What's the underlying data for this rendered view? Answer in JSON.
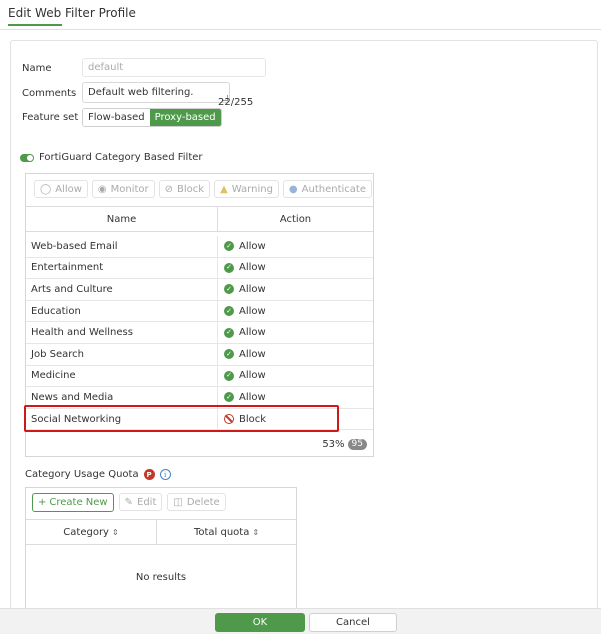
{
  "dialog": {
    "title": "Edit Web Filter Profile"
  },
  "form": {
    "name_label": "Name",
    "name_value": "default",
    "comments_label": "Comments",
    "comments_value": "Default web filtering.",
    "comments_counter": "22/255",
    "feature_set_label": "Feature set",
    "feature_set_options": [
      "Flow-based",
      "Proxy-based"
    ],
    "feature_set_selected": "Proxy-based"
  },
  "fortiguard": {
    "enabled": true,
    "title": "FortiGuard Category Based Filter",
    "toolbar": [
      {
        "label": "Allow",
        "icon": "check-circle-icon"
      },
      {
        "label": "Monitor",
        "icon": "eye-icon"
      },
      {
        "label": "Block",
        "icon": "block-icon"
      },
      {
        "label": "Warning",
        "icon": "warning-icon"
      },
      {
        "label": "Authenticate",
        "icon": "user-icon"
      }
    ],
    "columns": {
      "name": "Name",
      "action": "Action"
    },
    "rows": [
      {
        "name": "Web-based Email",
        "action": "Allow"
      },
      {
        "name": "Entertainment",
        "action": "Allow"
      },
      {
        "name": "Arts and Culture",
        "action": "Allow"
      },
      {
        "name": "Education",
        "action": "Allow"
      },
      {
        "name": "Health and Wellness",
        "action": "Allow"
      },
      {
        "name": "Job Search",
        "action": "Allow"
      },
      {
        "name": "Medicine",
        "action": "Allow"
      },
      {
        "name": "News and Media",
        "action": "Allow"
      },
      {
        "name": "Social Networking",
        "action": "Block"
      }
    ],
    "footer_percent": "53%",
    "footer_count": "95"
  },
  "quota": {
    "title": "Category Usage Quota",
    "badge": "P",
    "info": "i",
    "toolbar": {
      "create": "Create New",
      "edit": "Edit",
      "delete": "Delete"
    },
    "columns": {
      "category": "Category",
      "total": "Total quota"
    },
    "empty": "No results"
  },
  "buttons": {
    "ok": "OK",
    "cancel": "Cancel"
  },
  "colors": {
    "accent": "#4e9a4a",
    "block": "#c0392b",
    "highlight": "#cc1a1a"
  }
}
